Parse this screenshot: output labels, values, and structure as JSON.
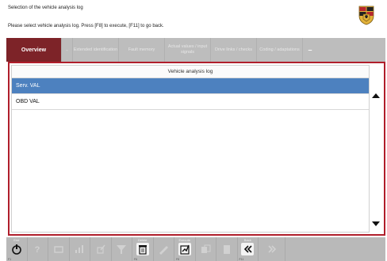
{
  "header": {
    "title": "Selection of the vehicle analysis log",
    "instruction": "Please select vehicle analysis log. Press [F8] to execute, [F11] to go back."
  },
  "tabs": [
    {
      "label": "Overview",
      "active": true,
      "width": 70
    },
    {
      "label": "-",
      "active": false,
      "width": 14
    },
    {
      "label": "Extended identification",
      "active": false,
      "width": 58
    },
    {
      "label": "Fault memory",
      "active": false,
      "width": 58
    },
    {
      "label": "Actual values / input signals",
      "active": false,
      "width": 58
    },
    {
      "label": "Drive links / checks",
      "active": false,
      "width": 58
    },
    {
      "label": "Coding / adaptations",
      "active": false,
      "width": 58
    },
    {
      "label": "–",
      "active": false,
      "width": 18
    }
  ],
  "list": {
    "header": "Vehicle analysis log",
    "rows": [
      {
        "label": "Serv. VAL",
        "selected": true
      },
      {
        "label": "OBD VAL",
        "selected": false
      }
    ]
  },
  "toolbar": {
    "buttons": [
      {
        "name": "end-button",
        "label": "End",
        "fkey": "F1",
        "icon": "power-icon",
        "enabled": true
      },
      {
        "name": "help-button",
        "label": "",
        "fkey": "",
        "icon": "help-icon",
        "enabled": false
      },
      {
        "name": "display-button",
        "label": "",
        "fkey": "",
        "icon": "display-icon",
        "enabled": false
      },
      {
        "name": "chart-button",
        "label": "",
        "fkey": "",
        "icon": "chart-icon",
        "enabled": false
      },
      {
        "name": "edit-button",
        "label": "",
        "fkey": "",
        "icon": "edit-icon",
        "enabled": false
      },
      {
        "name": "filter-button",
        "label": "",
        "fkey": "",
        "icon": "filter-icon",
        "enabled": false
      },
      {
        "name": "delete-button",
        "label": "Delete",
        "fkey": "F6",
        "icon": "trash-icon",
        "enabled": true
      },
      {
        "name": "pen-button",
        "label": "",
        "fkey": "",
        "icon": "pen-icon",
        "enabled": false
      },
      {
        "name": "execute-button",
        "label": "Execute",
        "fkey": "F8",
        "icon": "execute-icon",
        "enabled": true
      },
      {
        "name": "copy-button",
        "label": "",
        "fkey": "",
        "icon": "copy-icon",
        "enabled": false
      },
      {
        "name": "document-button",
        "label": "",
        "fkey": "",
        "icon": "document-icon",
        "enabled": false
      },
      {
        "name": "back-button",
        "label": "Back",
        "fkey": "F11",
        "icon": "double-chevron-left-icon",
        "enabled": true
      },
      {
        "name": "forward-button",
        "label": "",
        "fkey": "",
        "icon": "double-chevron-right-icon",
        "enabled": false
      }
    ]
  },
  "colors": {
    "accent": "#7d2328",
    "panel_border": "#b01e2b",
    "selection": "#4d81bf",
    "toolbar_bg": "#b9b9b9"
  }
}
